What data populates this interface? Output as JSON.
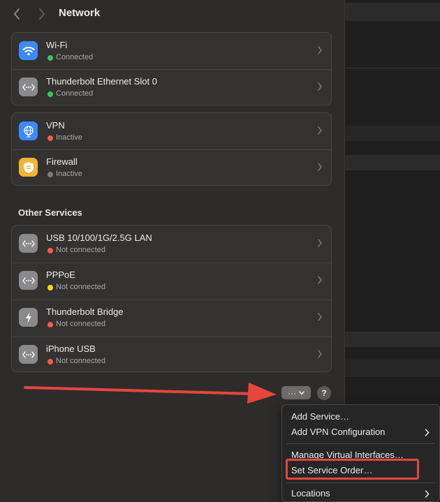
{
  "window": {
    "title": "Network"
  },
  "connections": [
    {
      "name": "Wi-Fi",
      "status": "Connected",
      "icon": "wifi-icon",
      "status_color": "#34c759"
    },
    {
      "name": "Thunderbolt Ethernet Slot 0",
      "status": "Connected",
      "icon": "ethernet-icon",
      "status_color": "#34c759"
    }
  ],
  "security": [
    {
      "name": "VPN",
      "status": "Inactive",
      "icon": "vpn-globe-icon",
      "status_color": "#ff5a44"
    },
    {
      "name": "Firewall",
      "status": "Inactive",
      "icon": "firewall-shield-icon",
      "status_color": "#7d7d7d"
    }
  ],
  "other_services": {
    "title": "Other Services",
    "items": [
      {
        "name": "USB 10/100/1G/2.5G LAN",
        "status": "Not connected",
        "icon": "ethernet-icon",
        "status_color": "#ff5a44"
      },
      {
        "name": "PPPoE",
        "status": "Not connected",
        "icon": "ethernet-icon",
        "status_color": "#ffd60a"
      },
      {
        "name": "Thunderbolt Bridge",
        "status": "Not connected",
        "icon": "thunderbolt-icon",
        "status_color": "#ff5a44"
      },
      {
        "name": "iPhone USB",
        "status": "Not connected",
        "icon": "ethernet-icon",
        "status_color": "#ff5a44"
      }
    ]
  },
  "actions": {
    "more_label": "···",
    "help_label": "?"
  },
  "action_menu": {
    "items": [
      {
        "label": "Add Service…",
        "submenu": false
      },
      {
        "label": "Add VPN Configuration",
        "submenu": true
      },
      {
        "label": "Manage Virtual Interfaces…",
        "submenu": false
      },
      {
        "label": "Set Service Order…",
        "submenu": false
      },
      {
        "label": "Locations",
        "submenu": true
      }
    ]
  },
  "colors": {
    "accent": "#3d8af7",
    "annotation": "#e8453c"
  }
}
